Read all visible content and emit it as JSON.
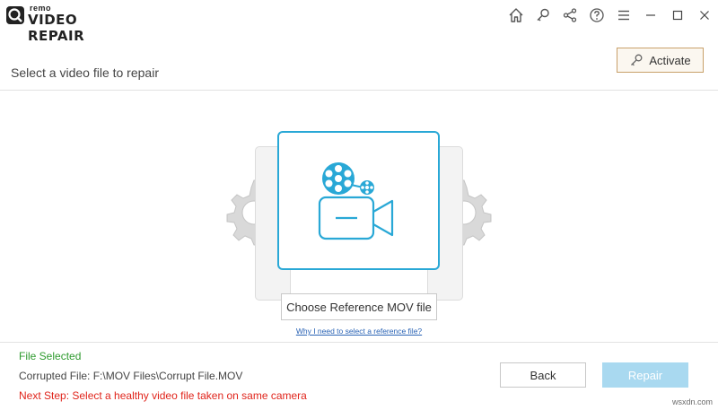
{
  "app": {
    "brand": "remo",
    "product": "VIDEO REPAIR"
  },
  "titlebar_icons": [
    "home-icon",
    "search-key-icon",
    "share-icon",
    "help-icon",
    "menu-icon",
    "minimize-icon",
    "maximize-icon",
    "close-icon"
  ],
  "header": {
    "title": "Select a video file to repair",
    "activate_label": "Activate"
  },
  "stage": {
    "choose_label": "Choose Reference MOV file",
    "why_link": "Why I need to select a reference file?"
  },
  "footer": {
    "status": "File Selected",
    "corrupted_file": "Corrupted File: F:\\MOV Files\\Corrupt File.MOV",
    "next_step": "Next Step: Select a healthy video file taken on same camera",
    "back_label": "Back",
    "repair_label": "Repair",
    "repair_enabled": false
  },
  "watermark": "wsxdn.com",
  "colors": {
    "accent": "#29a8d6",
    "success": "#2e9a2e",
    "error": "#e0241b",
    "repair_disabled": "#a9d9f0",
    "activate_border": "#c8a06a"
  }
}
